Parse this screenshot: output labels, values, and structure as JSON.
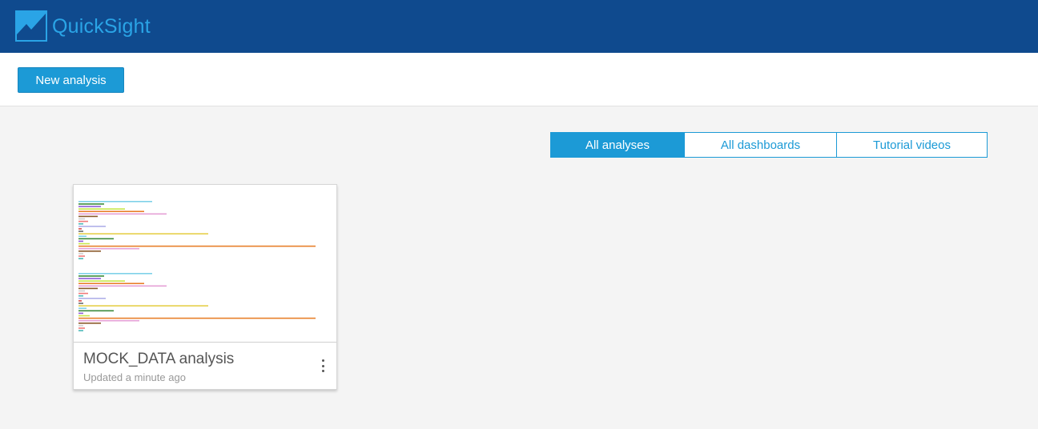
{
  "header": {
    "app_name": "QuickSight",
    "logo_icon": "quicksight-logo-icon",
    "colors": {
      "bar": "#0f4a8e",
      "accent": "#2aa4e6"
    }
  },
  "actions": {
    "new_analysis_label": "New analysis"
  },
  "tabs": [
    {
      "label": "All analyses",
      "active": true
    },
    {
      "label": "All dashboards",
      "active": false
    },
    {
      "label": "Tutorial videos",
      "active": false
    }
  ],
  "cards": [
    {
      "title": "MOCK_DATA analysis",
      "subtitle": "Updated a minute ago",
      "menu_icon": "more-vertical-icon"
    }
  ]
}
